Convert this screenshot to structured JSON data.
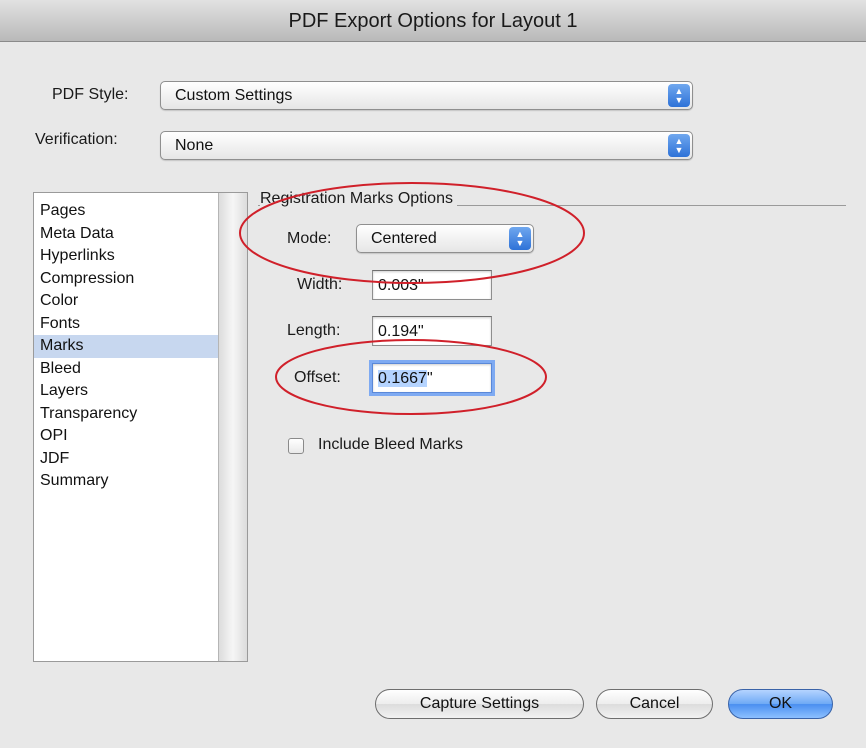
{
  "window": {
    "title": "PDF Export Options for Layout 1"
  },
  "pdf_style": {
    "label": "PDF Style:",
    "value": "Custom Settings"
  },
  "verification": {
    "label": "Verification:",
    "value": "None"
  },
  "sidebar": {
    "items": [
      {
        "label": "Pages"
      },
      {
        "label": "Meta Data"
      },
      {
        "label": "Hyperlinks"
      },
      {
        "label": "Compression"
      },
      {
        "label": "Color"
      },
      {
        "label": "Fonts"
      },
      {
        "label": "Marks"
      },
      {
        "label": "Bleed"
      },
      {
        "label": "Layers"
      },
      {
        "label": "Transparency"
      },
      {
        "label": "OPI"
      },
      {
        "label": "JDF"
      },
      {
        "label": "Summary"
      }
    ],
    "selected": "Marks"
  },
  "registration": {
    "group_title": "Registration Marks Options",
    "mode_label": "Mode:",
    "mode_value": "Centered",
    "width_label": "Width:",
    "width_value": "0.003\"",
    "length_label": "Length:",
    "length_value": "0.194\"",
    "offset_label": "Offset:",
    "offset_value_selected": "0.1667",
    "offset_value_rest": "\"",
    "bleed_marks_label": "Include Bleed Marks",
    "bleed_marks_checked": false
  },
  "buttons": {
    "capture": "Capture Settings",
    "cancel": "Cancel",
    "ok": "OK"
  },
  "colors": {
    "annotation": "#d0202a",
    "selection": "#c7d7ef",
    "default_button": "#4a8ff0"
  }
}
